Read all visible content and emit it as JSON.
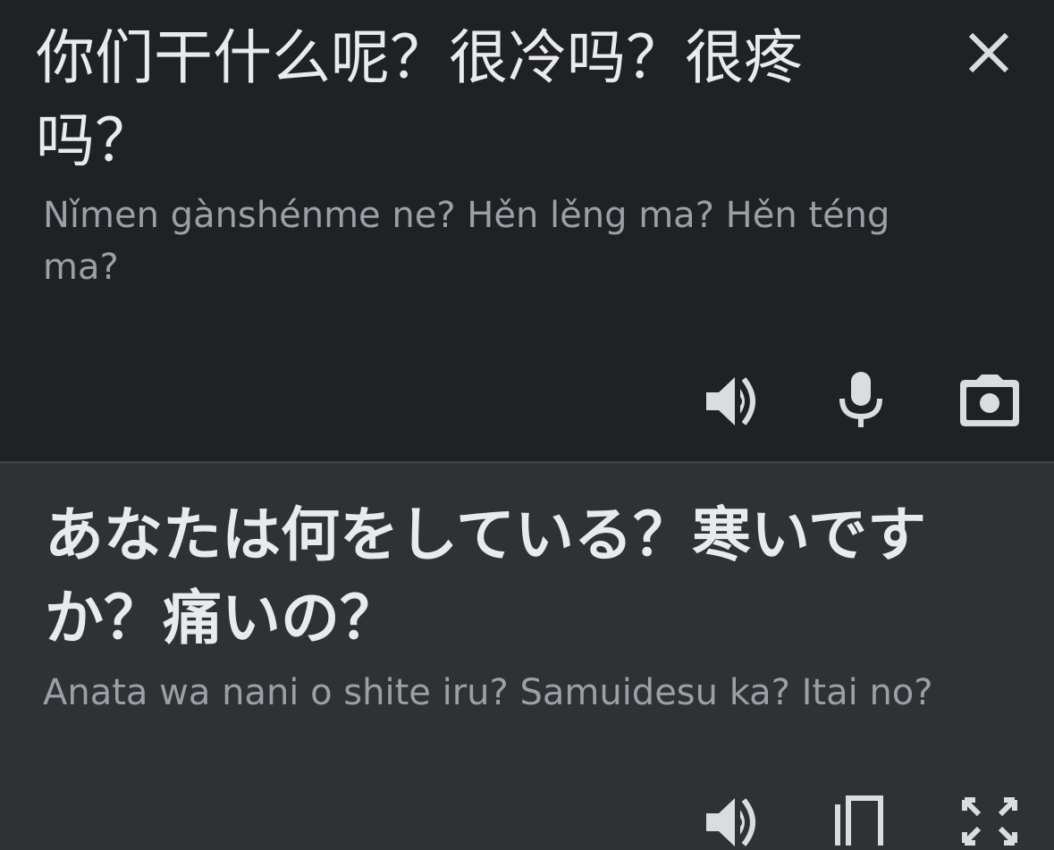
{
  "source": {
    "text": "你们干什么呢？很冷吗？很疼吗？",
    "romanization": "Nǐmen gànshénme ne? Hěn lěng ma? Hěn téng ma?",
    "actions": [
      "close-icon",
      "speaker-icon",
      "microphone-icon",
      "camera-icon"
    ]
  },
  "translation": {
    "text": "あなたは何をしている？寒いですか？痛いの？",
    "romanization": "Anata wa nani o shite iru? Samuidesu ka? Itai no?",
    "actions": [
      "speaker-icon",
      "copy-icon",
      "fullscreen-icon"
    ]
  },
  "colors": {
    "source_bg": "#202124",
    "target_bg": "#303134",
    "primary_text": "#e8eaed",
    "secondary_text": "#9aa0a6",
    "icon": "#dadce0"
  }
}
